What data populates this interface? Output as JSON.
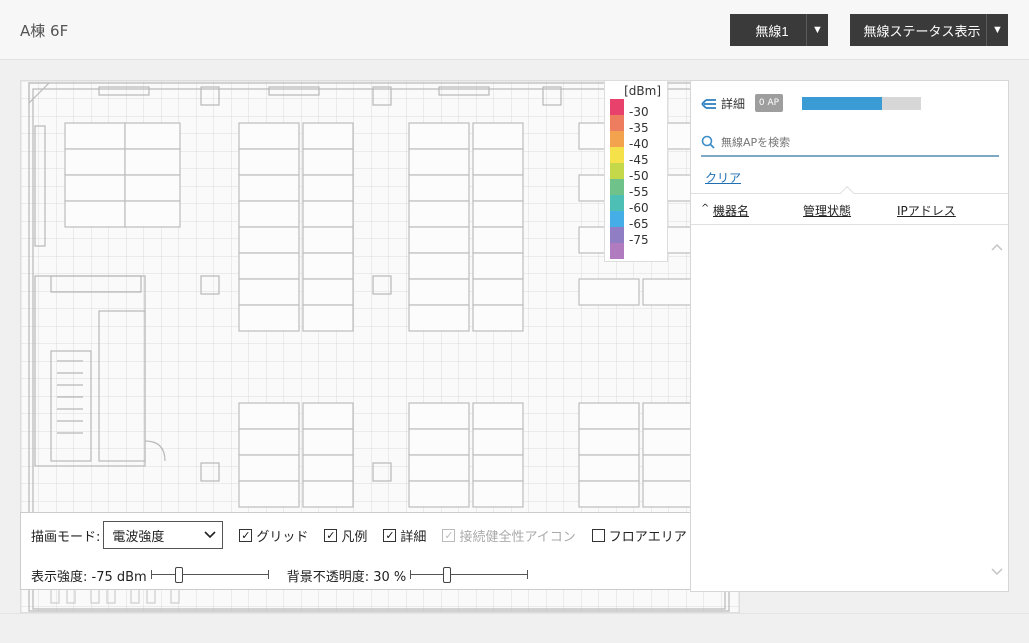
{
  "header": {
    "title": "A棟 6F",
    "wireless_dropdown": "無線1",
    "status_dropdown": "無線ステータス表示"
  },
  "legend": {
    "unit": "[dBm]",
    "levels": [
      {
        "label": "-30",
        "color": "#e8426c"
      },
      {
        "label": "-35",
        "color": "#ee7c5e"
      },
      {
        "label": "-40",
        "color": "#f3a34e"
      },
      {
        "label": "-45",
        "color": "#f5e24a"
      },
      {
        "label": "-50",
        "color": "#c5d84a"
      },
      {
        "label": "-55",
        "color": "#6fc289"
      },
      {
        "label": "-60",
        "color": "#4dbfb4"
      },
      {
        "label": "-65",
        "color": "#46aee6"
      },
      {
        "label": "-75",
        "color": "#8f7ec4"
      },
      {
        "label": "",
        "color": "#b07bbf"
      }
    ]
  },
  "controls": {
    "draw_mode_label": "描画モード:",
    "draw_mode_value": "電波強度",
    "checkboxes": [
      {
        "label": "グリッド",
        "checked": true,
        "disabled": false
      },
      {
        "label": "凡例",
        "checked": true,
        "disabled": false
      },
      {
        "label": "詳細",
        "checked": true,
        "disabled": false
      },
      {
        "label": "接続健全性アイコン",
        "checked": true,
        "disabled": true
      },
      {
        "label": "フロアエリア",
        "checked": false,
        "disabled": false
      }
    ],
    "strength_label": "表示強度: -75 dBm",
    "strength_position": 0.22,
    "opacity_label": "背景不透明度: 30 %",
    "opacity_position": 0.3
  },
  "side_panel": {
    "detail_label": "詳細",
    "ap_badge": "0 AP",
    "ap_bar_fill": 0.67,
    "ap_bar_color": "#3b9bd4",
    "search_placeholder": "無線APを検索",
    "clear_label": "クリア",
    "columns": [
      "機器名",
      "管理状態",
      "IPアドレス"
    ],
    "sort_indicator": "^"
  }
}
